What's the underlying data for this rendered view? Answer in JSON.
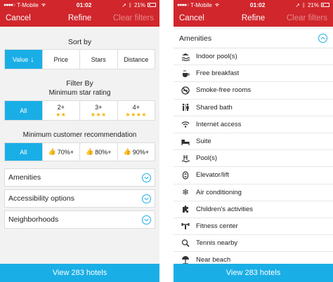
{
  "status_bar": {
    "carrier": "T-Mobile",
    "time": "01:02",
    "battery": "21%"
  },
  "nav": {
    "cancel": "Cancel",
    "title": "Refine",
    "clear": "Clear filters"
  },
  "sort": {
    "title": "Sort by",
    "options": [
      {
        "label": "Value",
        "active": true
      },
      {
        "label": "Price",
        "active": false
      },
      {
        "label": "Stars",
        "active": false
      },
      {
        "label": "Distance",
        "active": false
      }
    ]
  },
  "filter": {
    "title": "Filter By",
    "star_title": "Minimum star rating",
    "star_options": [
      {
        "label": "All",
        "stars": "",
        "active": true
      },
      {
        "label": "2+",
        "stars": "★★",
        "active": false
      },
      {
        "label": "3+",
        "stars": "★★★",
        "active": false
      },
      {
        "label": "4+",
        "stars": "★★★★",
        "active": false
      }
    ],
    "rec_title": "Minimum customer recommendation",
    "rec_options": [
      {
        "label": "All",
        "active": true
      },
      {
        "label": "70%+",
        "active": false
      },
      {
        "label": "80%+",
        "active": false
      },
      {
        "label": "90%+",
        "active": false
      }
    ]
  },
  "accordions": [
    {
      "label": "Amenities"
    },
    {
      "label": "Accessibility options"
    },
    {
      "label": "Neighborhoods"
    }
  ],
  "footer": {
    "label": "View 283 hotels"
  },
  "amenities": {
    "header": "Amenities",
    "items": [
      {
        "label": "Indoor pool(s)",
        "icon": "indoor-pool-icon"
      },
      {
        "label": "Free breakfast",
        "icon": "breakfast-icon"
      },
      {
        "label": "Smoke-free rooms",
        "icon": "no-smoking-icon"
      },
      {
        "label": "Shared bath",
        "icon": "shared-bath-icon"
      },
      {
        "label": "Internet access",
        "icon": "wifi-icon"
      },
      {
        "label": "Suite",
        "icon": "suite-icon"
      },
      {
        "label": "Pool(s)",
        "icon": "pool-icon"
      },
      {
        "label": "Elevator/lift",
        "icon": "elevator-icon"
      },
      {
        "label": "Air conditioning",
        "icon": "snowflake-icon"
      },
      {
        "label": "Children's activities",
        "icon": "puzzle-icon"
      },
      {
        "label": "Fitness center",
        "icon": "fitness-icon"
      },
      {
        "label": "Tennis nearby",
        "icon": "tennis-icon"
      },
      {
        "label": "Near beach",
        "icon": "beach-icon"
      }
    ]
  },
  "colors": {
    "brand_red": "#d0262c",
    "accent_blue": "#1aaee6",
    "star_gold": "#f4b400"
  }
}
